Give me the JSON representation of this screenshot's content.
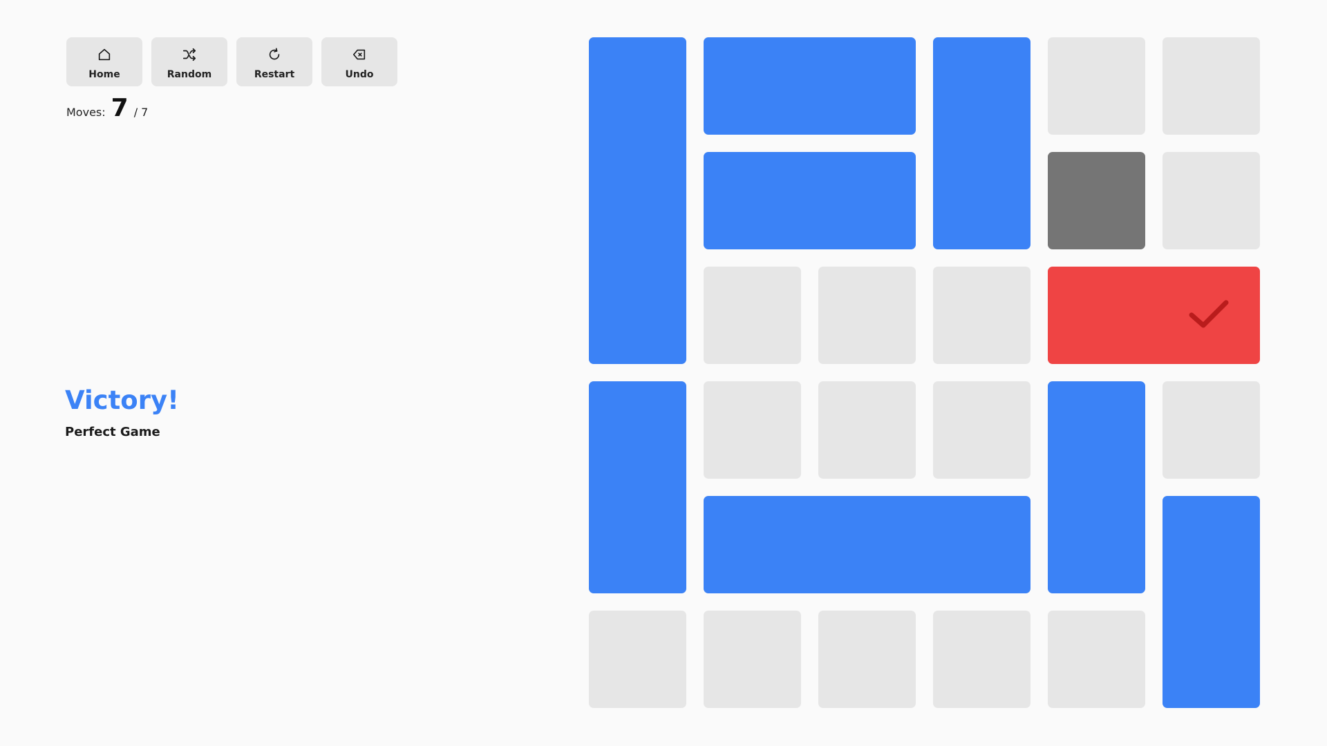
{
  "toolbar": {
    "buttons": [
      {
        "label": "Home",
        "icon": "home-icon"
      },
      {
        "label": "Random",
        "icon": "shuffle-icon"
      },
      {
        "label": "Restart",
        "icon": "restart-icon"
      },
      {
        "label": "Undo",
        "icon": "undo-icon"
      }
    ]
  },
  "moves": {
    "label": "Moves:",
    "count": "7",
    "total": "/ 7"
  },
  "result": {
    "title": "Victory!",
    "subtitle": "Perfect Game"
  },
  "colors": {
    "blue": "#3b82f6",
    "red": "#ef4444",
    "gray": "#757575",
    "empty": "#e6e6e6",
    "accent": "#3b82f6"
  },
  "board": {
    "rows": 6,
    "cols": 6,
    "exit_row": 2,
    "blocks": [
      {
        "type": "blue",
        "row": 0,
        "col": 0,
        "w": 1,
        "h": 3
      },
      {
        "type": "blue",
        "row": 0,
        "col": 1,
        "w": 2,
        "h": 1
      },
      {
        "type": "blue",
        "row": 0,
        "col": 3,
        "w": 1,
        "h": 2
      },
      {
        "type": "blue",
        "row": 1,
        "col": 1,
        "w": 2,
        "h": 1
      },
      {
        "type": "gray",
        "row": 1,
        "col": 4,
        "w": 1,
        "h": 1
      },
      {
        "type": "red",
        "row": 2,
        "col": 4,
        "w": 2,
        "h": 1
      },
      {
        "type": "blue",
        "row": 3,
        "col": 0,
        "w": 1,
        "h": 2
      },
      {
        "type": "blue",
        "row": 3,
        "col": 4,
        "w": 1,
        "h": 2
      },
      {
        "type": "blue",
        "row": 4,
        "col": 1,
        "w": 3,
        "h": 1
      },
      {
        "type": "blue",
        "row": 4,
        "col": 5,
        "w": 1,
        "h": 2
      }
    ]
  }
}
